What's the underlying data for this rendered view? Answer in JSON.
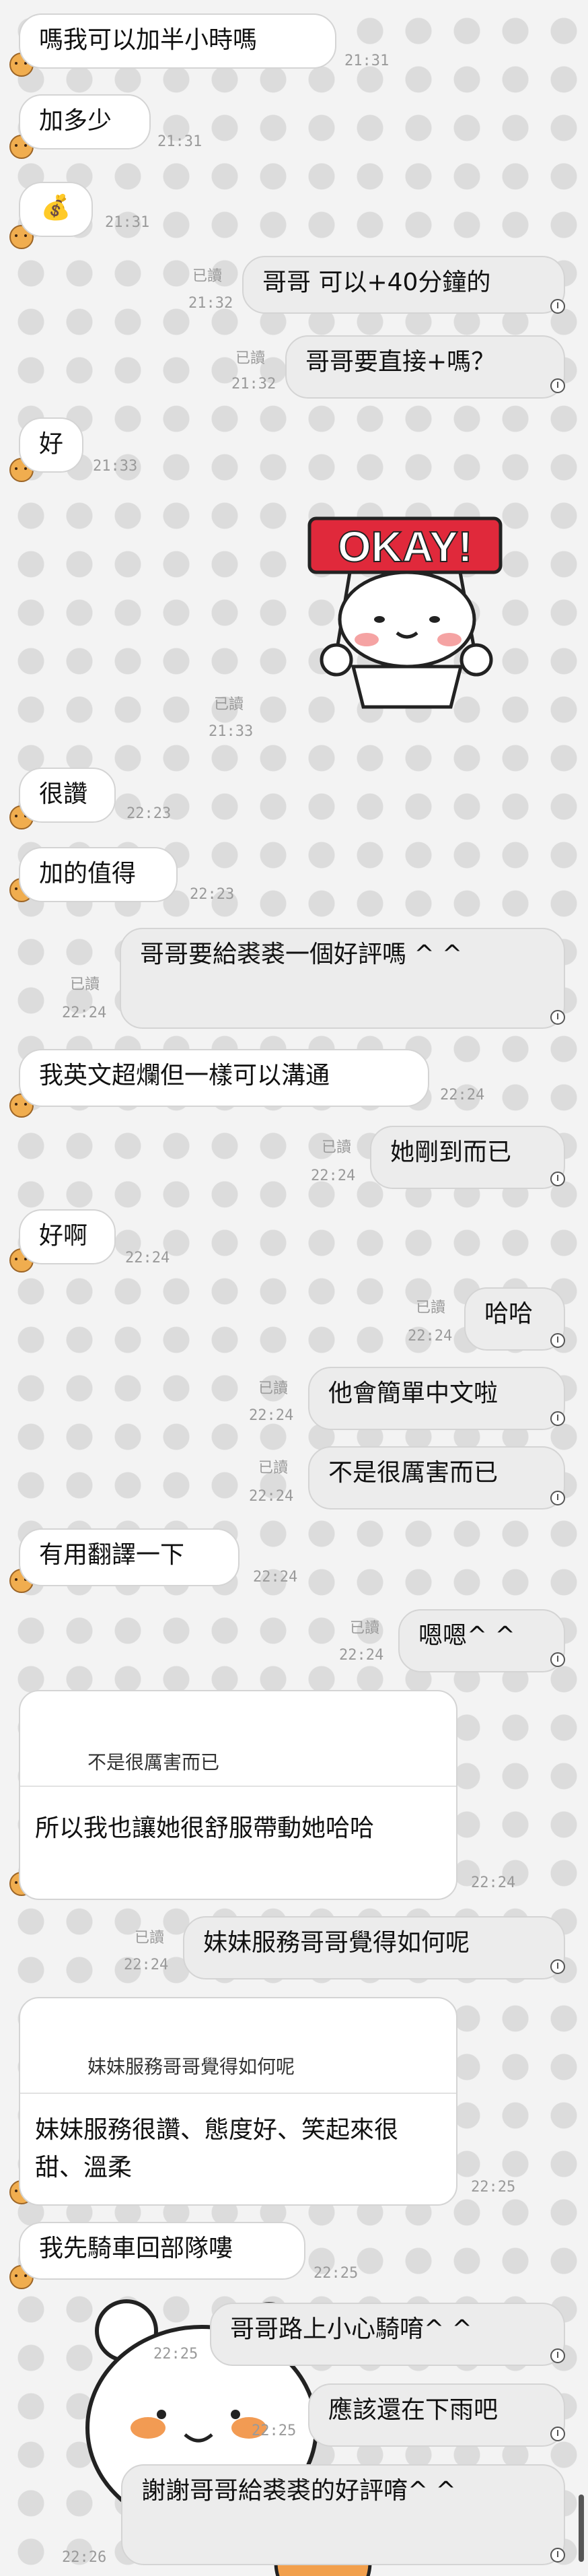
{
  "messages": [
    {
      "text": "嗎我可以加半小時嗎",
      "time": "21:31"
    },
    {
      "text": "加多少",
      "time": "21:31"
    },
    {
      "icon": "money-bag-icon",
      "glyph": "💰",
      "time": "21:31"
    },
    {
      "text": "哥哥  可以+40分鐘的",
      "time": "21:32",
      "read": "已讀"
    },
    {
      "text": "哥哥要直接+嗎？",
      "time": "21:32",
      "read": "已讀"
    },
    {
      "text": "好",
      "time": "21:33"
    },
    {
      "sticker_text": "OKAY!",
      "time": "21:33",
      "read": "已讀"
    },
    {
      "text": "很讚",
      "time": "22:23"
    },
    {
      "text": "加的值得",
      "time": "22:23"
    },
    {
      "text": "哥哥要給裘裘一個好評嗎 ^ ^",
      "time": "22:24",
      "read": "已讀"
    },
    {
      "text": "我英文超爛但一樣可以溝通",
      "time": "22:24"
    },
    {
      "text": "她剛到而已",
      "time": "22:24",
      "read": "已讀"
    },
    {
      "text": "好啊",
      "time": "22:24"
    },
    {
      "text": "哈哈",
      "time": "22:24",
      "read": "已讀"
    },
    {
      "text": "他會簡單中文啦",
      "time": "22:24",
      "read": "已讀"
    },
    {
      "text": "不是很厲害而已",
      "time": "22:24",
      "read": "已讀"
    },
    {
      "text": "有用翻譯一下",
      "time": "22:24"
    },
    {
      "text": "嗯嗯^ ^",
      "time": "22:24",
      "read": "已讀"
    },
    {
      "quote": "不是很厲害而已",
      "text": "所以我也讓她很舒服帶動她哈哈",
      "time": "22:24"
    },
    {
      "text": "妹妹服務哥哥覺得如何呢",
      "time": "22:24",
      "read": "已讀"
    },
    {
      "quote": "妹妹服務哥哥覺得如何呢",
      "text": "妹妹服務很讚、態度好、笑起來很甜、溫柔",
      "time": "22:25"
    },
    {
      "text": "我先騎車回部隊嘍",
      "time": "22:25"
    },
    {
      "text": "哥哥路上小心騎唷^ ^",
      "time": "22:25"
    },
    {
      "text": "應該還在下雨吧",
      "time": "22:25"
    },
    {
      "text": "謝謝哥哥給裘裘的好評唷^ ^",
      "time": "22:26"
    }
  ],
  "colors": {
    "background": "#f3f3f3",
    "incoming": "#ffffff",
    "outgoing": "#ececec",
    "avatar": "#f0ad4f"
  }
}
